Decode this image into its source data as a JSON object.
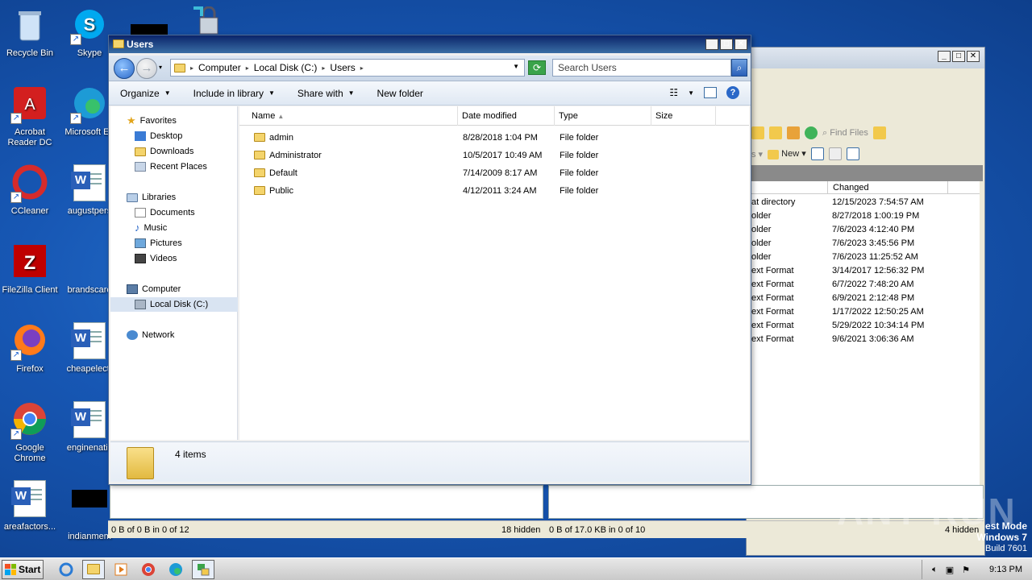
{
  "desktop": {
    "icons": [
      {
        "label": "Recycle Bin"
      },
      {
        "label": "Skype"
      },
      {
        "label": "Acrobat Reader DC"
      },
      {
        "label": "Microsoft Ed"
      },
      {
        "label": "CCleaner"
      },
      {
        "label": "augustpers"
      },
      {
        "label": "FileZilla Client"
      },
      {
        "label": "brandscare"
      },
      {
        "label": "Firefox"
      },
      {
        "label": "cheapelectr"
      },
      {
        "label": "Google Chrome"
      },
      {
        "label": "enginenatic"
      },
      {
        "label": "areafactors..."
      },
      {
        "label": "indianmem"
      }
    ]
  },
  "explorer": {
    "title": "Users",
    "address": {
      "segments": [
        "Computer",
        "Local Disk (C:)",
        "Users"
      ]
    },
    "search_placeholder": "Search Users",
    "toolbar": {
      "organize": "Organize",
      "include_in_library": "Include in library",
      "share_with": "Share with",
      "new_folder": "New folder",
      "help": "?"
    },
    "nav": {
      "favorites": "Favorites",
      "desktop": "Desktop",
      "downloads": "Downloads",
      "recent_places": "Recent Places",
      "libraries": "Libraries",
      "documents": "Documents",
      "music": "Music",
      "pictures": "Pictures",
      "videos": "Videos",
      "computer": "Computer",
      "local_disk": "Local Disk (C:)",
      "network": "Network"
    },
    "columns": {
      "name": "Name",
      "date_modified": "Date modified",
      "type": "Type",
      "size": "Size"
    },
    "files": [
      {
        "name": "admin",
        "date": "8/28/2018 1:04 PM",
        "type": "File folder"
      },
      {
        "name": "Administrator",
        "date": "10/5/2017 10:49 AM",
        "type": "File folder"
      },
      {
        "name": "Default",
        "date": "7/14/2009 8:17 AM",
        "type": "File folder"
      },
      {
        "name": "Public",
        "date": "4/12/2011 3:24 AM",
        "type": "File folder"
      }
    ],
    "details_count": "4 items"
  },
  "background_app": {
    "find_files": "Find Files",
    "new_label": "New",
    "changed_header": "Changed",
    "rows": [
      {
        "type": "at directory",
        "changed": "12/15/2023 7:54:57 AM"
      },
      {
        "type": "older",
        "changed": "8/27/2018 1:00:19 PM"
      },
      {
        "type": "older",
        "changed": "7/6/2023 4:12:40 PM"
      },
      {
        "type": "older",
        "changed": "7/6/2023 3:45:56 PM"
      },
      {
        "type": "older",
        "changed": "7/6/2023 11:25:52 AM"
      },
      {
        "type": "ext Format",
        "changed": "3/14/2017 12:56:32 PM"
      },
      {
        "type": "ext Format",
        "changed": "6/7/2022 7:48:20 AM"
      },
      {
        "type": "ext Format",
        "changed": "6/9/2021 2:12:48 PM"
      },
      {
        "type": "ext Format",
        "changed": "1/17/2022 12:50:25 AM"
      },
      {
        "type": "ext Format",
        "changed": "5/29/2022 10:34:14 PM"
      },
      {
        "type": "ext Format",
        "changed": "9/6/2021 3:06:36 AM"
      }
    ],
    "status_left": "0 B of 0 B in 0 of 12",
    "status_hidden1": "18 hidden",
    "status_mid": "0 B of 17.0 KB in 0 of 10",
    "status_hidden2": "4 hidden"
  },
  "watermark": "ANY RUN",
  "testmode": {
    "line1": "est Mode",
    "line2": "Windows 7",
    "line3": "Build 7601"
  },
  "taskbar": {
    "start": "Start",
    "clock": "9:13 PM"
  }
}
